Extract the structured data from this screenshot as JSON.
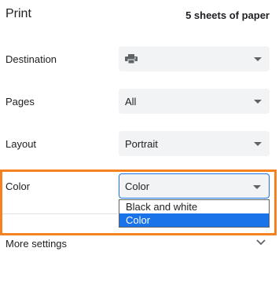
{
  "header": {
    "title": "Print",
    "sheets": "5 sheets of paper"
  },
  "destination": {
    "label": "Destination",
    "icon": "printer-icon",
    "value": ""
  },
  "pages": {
    "label": "Pages",
    "value": "All"
  },
  "layout": {
    "label": "Layout",
    "value": "Portrait"
  },
  "color": {
    "label": "Color",
    "value": "Color",
    "options": [
      "Black and white",
      "Color"
    ],
    "selected_index": 1,
    "highlight_color": "#f5821f",
    "accent_color": "#1a73e8"
  },
  "more_settings": {
    "label": "More settings",
    "icon": "chevron-down-icon"
  }
}
